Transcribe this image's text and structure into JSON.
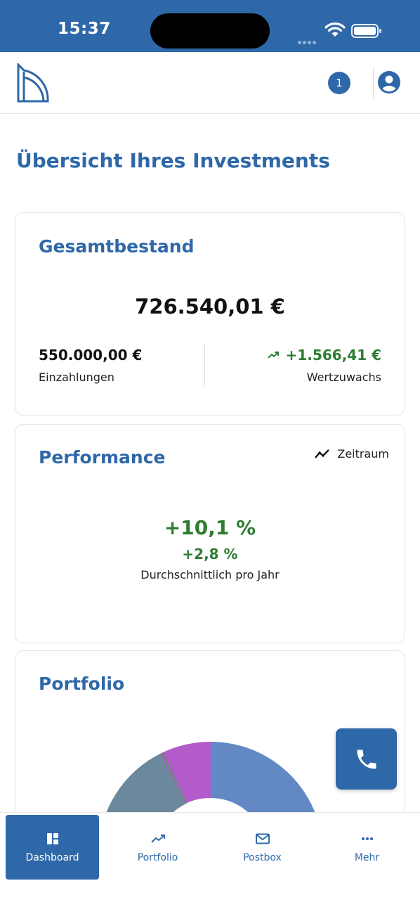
{
  "status_bar": {
    "time": "15:37"
  },
  "header": {
    "notification_count": "1"
  },
  "page_title": "Übersicht Ihres Investments",
  "total_card": {
    "title": "Gesamtbestand",
    "total_value": "726.540,01 €",
    "deposits_value": "550.000,00 €",
    "deposits_label": "Einzahlungen",
    "gain_value": "+1.566,41 €",
    "gain_label": "Wertzuwachs"
  },
  "performance_card": {
    "title": "Performance",
    "period_button_label": "Zeitraum",
    "total_performance": "+10,1 %",
    "annual_performance": "+2,8 %",
    "annual_label": "Durchschnittlich pro Jahr"
  },
  "portfolio_card": {
    "title": "Portfolio",
    "donut_colors": [
      "#6289c4",
      "#6b889c",
      "#b45bcb",
      "#4f9a5a"
    ]
  },
  "colors": {
    "brand": "#2f68a8",
    "positive": "#2e7d32"
  },
  "tabs": [
    {
      "label": "Dashboard",
      "icon": "dashboard-icon",
      "active": true
    },
    {
      "label": "Portfolio",
      "icon": "trend-icon",
      "active": false
    },
    {
      "label": "Postbox",
      "icon": "mail-icon",
      "active": false
    },
    {
      "label": "Mehr",
      "icon": "more-icon",
      "active": false
    }
  ]
}
